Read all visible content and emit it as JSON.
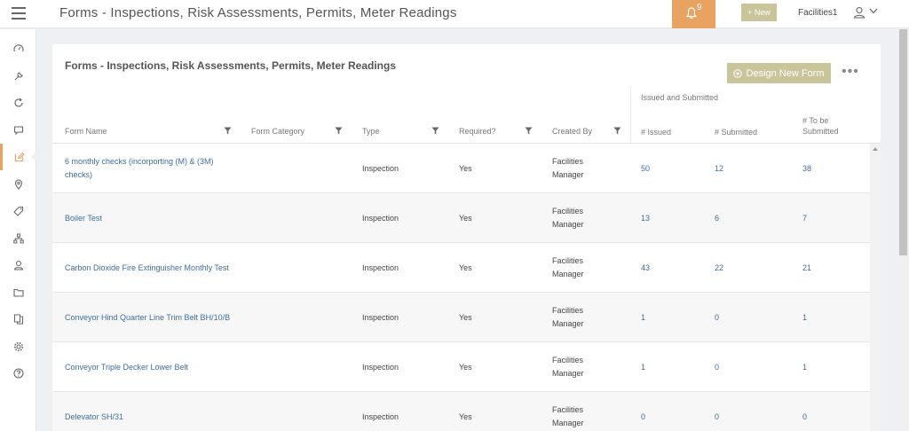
{
  "header": {
    "title": "Forms - Inspections, Risk Assessments, Permits, Meter Readings",
    "notification_count": "9",
    "new_label": "+ New",
    "user_name": "Facilities1"
  },
  "sidebar": {
    "items": [
      {
        "icon": "dashboard-icon"
      },
      {
        "icon": "wrench-icon"
      },
      {
        "icon": "refresh-icon"
      },
      {
        "icon": "chat-icon"
      },
      {
        "icon": "edit-form-icon",
        "active": true
      },
      {
        "icon": "location-pin-icon"
      },
      {
        "icon": "tag-icon"
      },
      {
        "icon": "hierarchy-icon"
      },
      {
        "icon": "contacts-icon"
      },
      {
        "icon": "folder-icon"
      },
      {
        "icon": "documents-icon"
      },
      {
        "icon": "gear-icon"
      },
      {
        "icon": "help-icon"
      }
    ]
  },
  "card": {
    "title": "Forms - Inspections, Risk Assessments, Permits, Meter Readings",
    "design_button": "Design New Form",
    "more_label": "•••",
    "group_header": "Issued and Submitted",
    "columns": {
      "form_name": "Form Name",
      "form_category": "Form Category",
      "type": "Type",
      "required": "Required?",
      "created_by": "Created By",
      "issued": "# Issued",
      "submitted": "# Submitted",
      "to_be_submitted": "# To be Submitted"
    }
  },
  "rows": [
    {
      "name": "6 monthly checks (incorporting (M) & (3M) checks)",
      "category": "",
      "type": "Inspection",
      "required": "Yes",
      "created_by": "Facilities Manager",
      "issued": "50",
      "submitted": "12",
      "to_be_submitted": "38"
    },
    {
      "name": "Boiler Test",
      "category": "",
      "type": "Inspection",
      "required": "Yes",
      "created_by": "Facilities Manager",
      "issued": "13",
      "submitted": "6",
      "to_be_submitted": "7"
    },
    {
      "name": "Carbon Dioxide Fire Extinguisher Monthly Test",
      "category": "",
      "type": "Inspection",
      "required": "Yes",
      "created_by": "Facilities Manager",
      "issued": "43",
      "submitted": "22",
      "to_be_submitted": "21"
    },
    {
      "name": "Conveyor Hind Quarter Line Trim Belt BH/10/B",
      "category": "",
      "type": "Inspection",
      "required": "Yes",
      "created_by": "Facilities Manager",
      "issued": "1",
      "submitted": "0",
      "to_be_submitted": "1"
    },
    {
      "name": "Conveyor Triple Decker Lower Belt",
      "category": "",
      "type": "Inspection",
      "required": "Yes",
      "created_by": "Facilities Manager",
      "issued": "1",
      "submitted": "0",
      "to_be_submitted": "1"
    },
    {
      "name": "Delevator SH/31",
      "category": "",
      "type": "Inspection",
      "required": "Yes",
      "created_by": "Facilities Manager",
      "issued": "0",
      "submitted": "0",
      "to_be_submitted": "0"
    }
  ],
  "colors": {
    "accent_orange": "#e8a262",
    "button_khaki": "#c9c49a",
    "link_blue": "#3f6d9c"
  }
}
